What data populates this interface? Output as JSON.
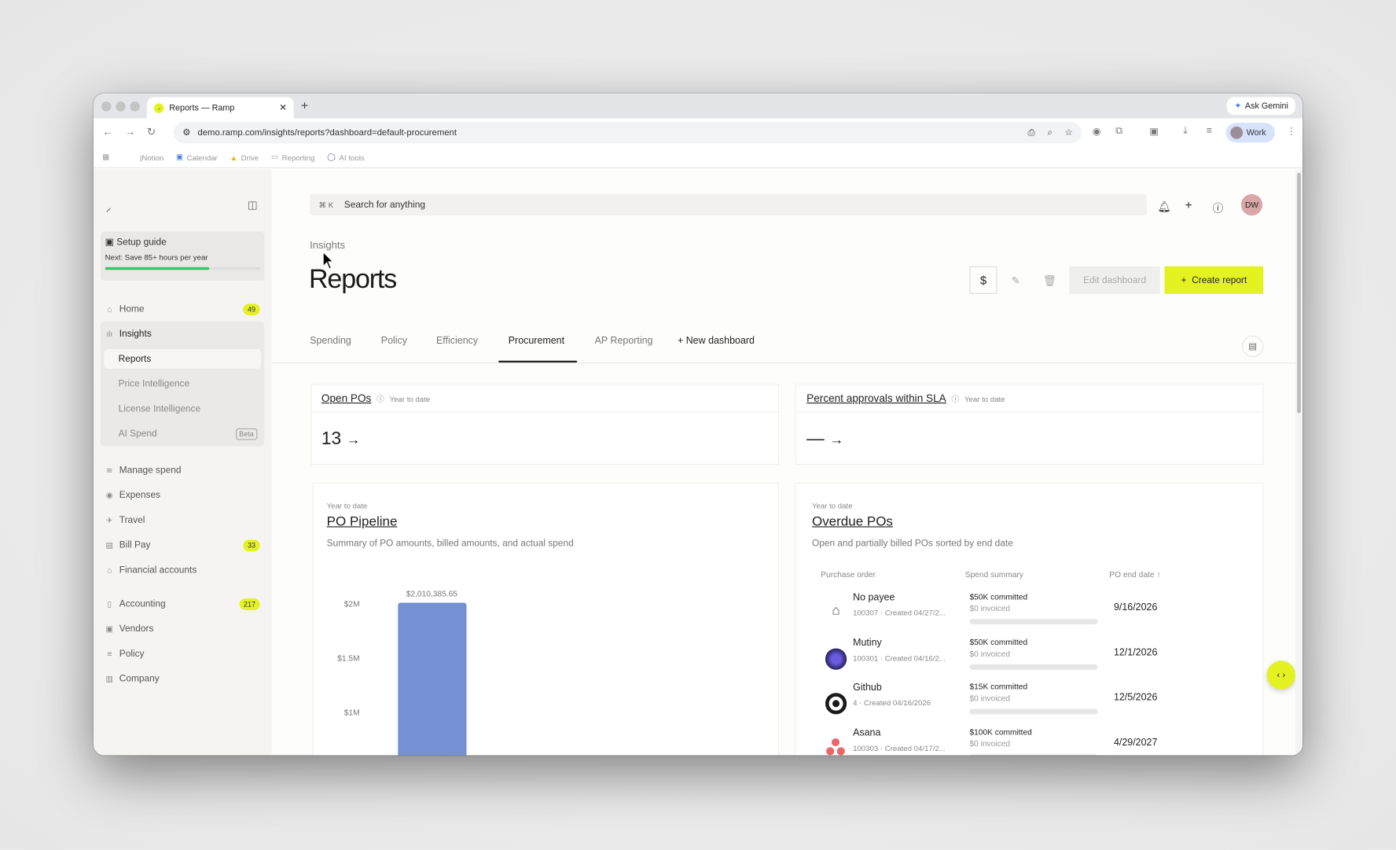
{
  "browser": {
    "tab_title": "Reports — Ramp",
    "url": "demo.ramp.com/insights/reports?dashboard=default-procurement",
    "ask_gemini": "Ask Gemini",
    "profile": "Work",
    "bookmarks": [
      "|Notion",
      "Calendar",
      "Drive",
      "Reporting",
      "AI tools"
    ]
  },
  "sidebar": {
    "setup_title": "Setup guide",
    "setup_next": "Next: Save 85+ hours per year",
    "setup_progress": 0.67,
    "items": [
      {
        "label": "Home",
        "badge": "49",
        "icon": "home-icon"
      },
      {
        "label": "Insights",
        "icon": "chart-icon"
      },
      {
        "label": "Manage spend",
        "icon": "layers-icon"
      },
      {
        "label": "Expenses",
        "icon": "coin-icon"
      },
      {
        "label": "Travel",
        "icon": "plane-icon"
      },
      {
        "label": "Bill Pay",
        "badge": "33",
        "icon": "bill-icon"
      },
      {
        "label": "Financial accounts",
        "icon": "bank-icon"
      },
      {
        "label": "Accounting",
        "badge": "217",
        "icon": "book-icon"
      },
      {
        "label": "Vendors",
        "icon": "store-icon"
      },
      {
        "label": "Policy",
        "icon": "sliders-icon"
      },
      {
        "label": "Company",
        "icon": "building-icon"
      }
    ],
    "insights_sub": [
      {
        "label": "Reports"
      },
      {
        "label": "Price Intelligence"
      },
      {
        "label": "License Intelligence"
      },
      {
        "label": "AI Spend",
        "badge": "Beta"
      }
    ]
  },
  "header": {
    "search_shortcut": "⌘ K",
    "search_placeholder": "Search for anything",
    "avatar": "DW"
  },
  "page": {
    "breadcrumb": "Insights",
    "title": "Reports",
    "edit_dashboard": "Edit dashboard",
    "create_report": "Create report",
    "tabs": [
      "Spending",
      "Policy",
      "Efficiency",
      "Procurement",
      "AP Reporting"
    ],
    "active_tab": "Procurement",
    "new_dashboard": "New dashboard"
  },
  "kpis": [
    {
      "title": "Open POs",
      "period": "Year to date",
      "value": "13"
    },
    {
      "title": "Percent approvals within SLA",
      "period": "Year to date",
      "value": "—"
    }
  ],
  "po_pipeline": {
    "period": "Year to date",
    "title": "PO Pipeline",
    "subtitle": "Summary of PO amounts, billed amounts, and actual spend"
  },
  "chart_data": {
    "type": "bar",
    "categories": [
      ""
    ],
    "values": [
      2010385.65
    ],
    "data_labels": [
      "$2,010,385.65"
    ],
    "yticks": [
      "$1M",
      "$1.5M",
      "$2M"
    ],
    "ylim": [
      0,
      2000000
    ],
    "color": "#7590d4"
  },
  "overdue": {
    "period": "Year to date",
    "title": "Overdue POs",
    "subtitle": "Open and partially billed POs sorted by end date",
    "columns": [
      "Purchase order",
      "Spend summary",
      "PO end date ↑"
    ],
    "rows": [
      {
        "name": "No payee",
        "meta": "100307 · Created 04/27/2...",
        "committed": "$50K committed",
        "invoiced": "$0 invoiced",
        "end": "9/16/2026"
      },
      {
        "name": "Mutiny",
        "meta": "100301 · Created 04/16/2...",
        "committed": "$50K committed",
        "invoiced": "$0 invoiced",
        "end": "12/1/2026"
      },
      {
        "name": "Github",
        "meta": "4 · Created 04/16/2026",
        "committed": "$15K committed",
        "invoiced": "$0 invoiced",
        "end": "12/5/2026"
      },
      {
        "name": "Asana",
        "meta": "100303 · Created 04/17/2...",
        "committed": "$100K committed",
        "invoiced": "$0 invoiced",
        "end": "4/29/2027"
      }
    ]
  },
  "colors": {
    "accent": "#e4f222",
    "bar": "#7590d4",
    "progress": "#3cc46a"
  }
}
